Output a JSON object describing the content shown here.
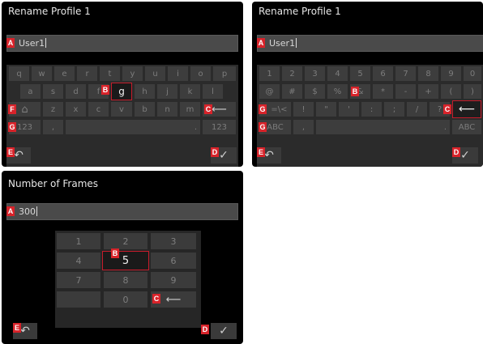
{
  "panel_a": {
    "title": "Rename Profile 1",
    "input_value": "User1",
    "rows": [
      [
        "q",
        "w",
        "e",
        "r",
        "t",
        "y",
        "u",
        "i",
        "o",
        "p"
      ],
      [
        "a",
        "s",
        "d",
        "f",
        "g",
        "h",
        "j",
        "k",
        "l"
      ],
      [
        "z",
        "x",
        "c",
        "v",
        "b",
        "n",
        "m"
      ]
    ],
    "selected_key": "g",
    "numeric_toggle": "123",
    "numeric_toggle_right": "123",
    "comma": ",",
    "period": "."
  },
  "panel_b": {
    "title": "Rename Profile 1",
    "input_value": "User1",
    "rows": [
      [
        "1",
        "2",
        "3",
        "4",
        "5",
        "6",
        "7",
        "8",
        "9",
        "0"
      ],
      [
        "@",
        "#",
        "$",
        "%",
        "&",
        "*",
        "-",
        "+",
        "(",
        ")"
      ],
      [
        "=\\<",
        "!",
        "\"",
        "'",
        ":",
        ";",
        "/",
        "?"
      ]
    ],
    "selected_key": "&",
    "alpha_toggle": "ABC",
    "alpha_toggle_right": "ABC",
    "comma": ",",
    "period": "."
  },
  "panel_c": {
    "title": "Number of Frames",
    "input_value": "300",
    "keys": [
      "1",
      "2",
      "3",
      "4",
      "5",
      "6",
      "7",
      "8",
      "9",
      "0"
    ],
    "selected_key": "5"
  },
  "labels": {
    "a": "A",
    "b": "B",
    "c": "C",
    "d": "D",
    "e": "E",
    "f": "F",
    "g": "G"
  },
  "icons": {
    "back": "↶",
    "ok": "✓",
    "backspace": "⟵",
    "shift": "⌂"
  },
  "colors": {
    "accent": "#d8232a",
    "panel_bg": "#000000",
    "key_bg": "#3d3d3d"
  }
}
